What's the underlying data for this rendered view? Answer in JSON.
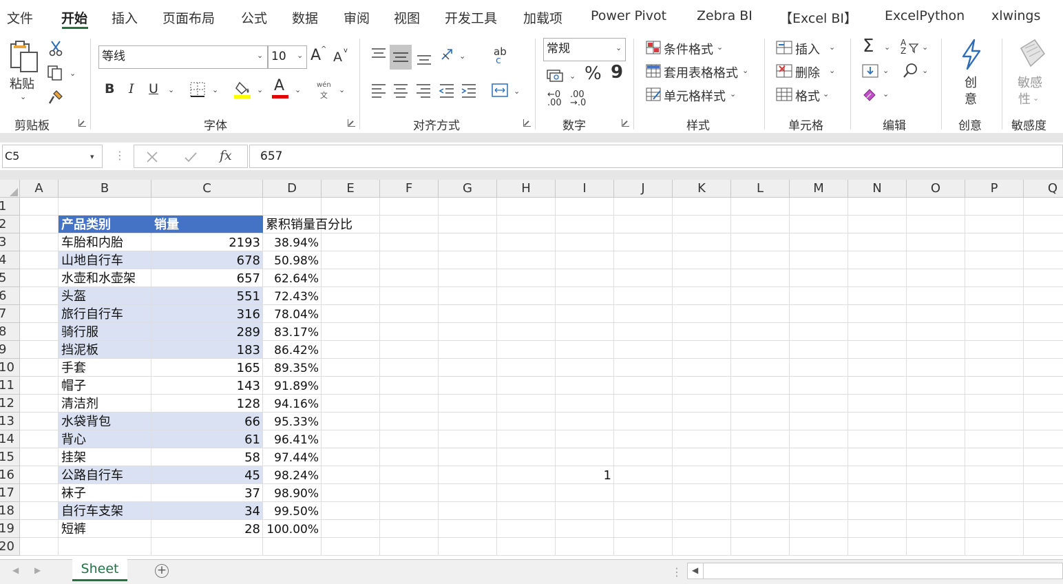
{
  "menu": {
    "tabs": [
      "文件",
      "开始",
      "插入",
      "页面布局",
      "公式",
      "数据",
      "审阅",
      "视图",
      "开发工具",
      "加载项",
      "Power Pivot",
      "Zebra BI",
      "【Excel BI】",
      "ExcelPython",
      "xlwings"
    ],
    "active": "开始"
  },
  "ribbon": {
    "clipboard": {
      "label": "剪贴板",
      "paste": "粘贴"
    },
    "font": {
      "label": "字体",
      "name": "等线",
      "size": "10",
      "bold": "B",
      "italic": "I",
      "underline": "U",
      "phonetic_top": "wén",
      "phonetic_bottom": "文",
      "grow": "A",
      "shrink": "A",
      "color_a": "A"
    },
    "alignment": {
      "label": "对齐方式",
      "wrap_top": "ab",
      "wrap_bottom": "c"
    },
    "number": {
      "label": "数字",
      "format": "常规",
      "percent": "%",
      "comma": "9",
      "inc_decimal": ".00",
      "inc_decimal_b": "←0",
      "dec_decimal": ".00",
      "dec_decimal_b": "→.0"
    },
    "styles": {
      "label": "样式",
      "conditional": "条件格式",
      "table": "套用表格格式",
      "cell": "单元格样式"
    },
    "cells": {
      "label": "单元格",
      "insert": "插入",
      "delete": "删除",
      "format": "格式"
    },
    "editing": {
      "label": "编辑",
      "sum": "Σ",
      "sort": "A Z"
    },
    "ideas": {
      "label": "创意",
      "btn_line1": "创",
      "btn_line2": "意"
    },
    "sensitivity": {
      "label": "敏感度",
      "btn_line1": "敏感",
      "btn_line2": "性"
    }
  },
  "formula_bar": {
    "name_box": "C5",
    "fx": "fx",
    "value": "657"
  },
  "grid": {
    "columns": [
      "A",
      "B",
      "C",
      "D",
      "E",
      "F",
      "G",
      "H",
      "I",
      "J",
      "K",
      "L",
      "M",
      "N",
      "O",
      "P",
      "Q"
    ],
    "rows": [
      "1",
      "2",
      "3",
      "4",
      "5",
      "6",
      "7",
      "8",
      "9",
      "10",
      "11",
      "12",
      "13",
      "14",
      "15",
      "16",
      "17",
      "18",
      "19",
      "20"
    ],
    "header": {
      "category": "产品类别",
      "sales": "销量",
      "cumulative": "累积销量百分比"
    },
    "data": [
      {
        "category": "车胎和内胎",
        "sales": "2193",
        "pct": "38.94%",
        "band": false
      },
      {
        "category": "山地自行车",
        "sales": "678",
        "pct": "50.98%",
        "band": true
      },
      {
        "category": "水壶和水壶架",
        "sales": "657",
        "pct": "62.64%",
        "band": false
      },
      {
        "category": "头盔",
        "sales": "551",
        "pct": "72.43%",
        "band": true
      },
      {
        "category": "旅行自行车",
        "sales": "316",
        "pct": "78.04%",
        "band": true
      },
      {
        "category": "骑行服",
        "sales": "289",
        "pct": "83.17%",
        "band": true
      },
      {
        "category": "挡泥板",
        "sales": "183",
        "pct": "86.42%",
        "band": true
      },
      {
        "category": "手套",
        "sales": "165",
        "pct": "89.35%",
        "band": false
      },
      {
        "category": "帽子",
        "sales": "143",
        "pct": "91.89%",
        "band": false
      },
      {
        "category": "清洁剂",
        "sales": "128",
        "pct": "94.16%",
        "band": false
      },
      {
        "category": "水袋背包",
        "sales": "66",
        "pct": "95.33%",
        "band": true
      },
      {
        "category": "背心",
        "sales": "61",
        "pct": "96.41%",
        "band": true
      },
      {
        "category": "挂架",
        "sales": "58",
        "pct": "97.44%",
        "band": false
      },
      {
        "category": "公路自行车",
        "sales": "45",
        "pct": "98.24%",
        "band": true
      },
      {
        "category": "袜子",
        "sales": "37",
        "pct": "98.90%",
        "band": false
      },
      {
        "category": "自行车支架",
        "sales": "34",
        "pct": "99.50%",
        "band": true
      },
      {
        "category": "短裤",
        "sales": "28",
        "pct": "100.00%",
        "band": false
      }
    ],
    "i16_value": "1"
  },
  "sheet_tabs": {
    "active": "Sheet",
    "add": "+"
  },
  "colors": {
    "accent": "#217346",
    "table_header": "#4472c4",
    "band": "#d9e1f2"
  }
}
